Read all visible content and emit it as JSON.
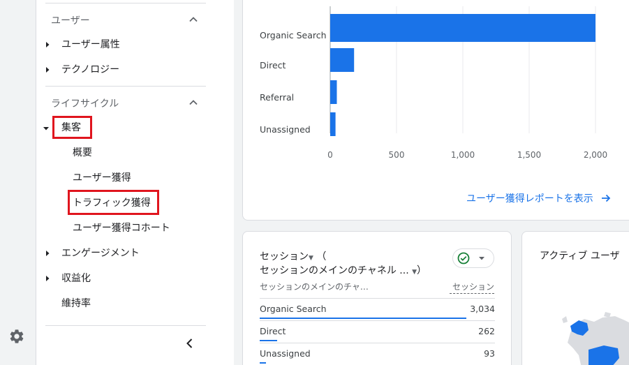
{
  "sidebar": {
    "sections": [
      {
        "title": "ユーザー"
      },
      {
        "title": "ライフサイクル"
      }
    ],
    "user_items": [
      "ユーザー属性",
      "テクノロジー"
    ],
    "lifecycle_items": {
      "acquisition": "集客",
      "acquisition_sub": [
        "概要",
        "ユーザー獲得",
        "トラフィック獲得",
        "ユーザー獲得コホート"
      ],
      "engagement": "エンゲージメント",
      "monetization": "収益化",
      "retention": "維持率"
    }
  },
  "accent_color": "#1a73e8",
  "highlight_color": "#e0151e",
  "chart_data": {
    "type": "bar",
    "orientation": "horizontal",
    "categories": [
      "Organic Search",
      "Direct",
      "Referral",
      "Unassigned"
    ],
    "values": [
      2000,
      180,
      50,
      40
    ],
    "xlim": [
      0,
      2000
    ],
    "xticks": [
      "0",
      "500",
      "1,000",
      "1,500",
      "2,000"
    ],
    "grid": true,
    "color": "#1a73e8"
  },
  "top_card": {
    "link_label": "ユーザー獲得レポートを表示"
  },
  "sessions_card": {
    "title_line1": "セッション",
    "title_paren_open": "（",
    "title_line2": "セッションのメインのチャネル ...",
    "title_paren_close": "）",
    "col_channel": "セッションのメインのチャ…",
    "col_sessions": "セッション",
    "rows": [
      {
        "label": "Organic Search",
        "value": "3,034",
        "fraction": 1.0
      },
      {
        "label": "Direct",
        "value": "262",
        "fraction": 0.086
      },
      {
        "label": "Unassigned",
        "value": "93",
        "fraction": 0.031
      }
    ]
  },
  "active_card": {
    "title": "アクティブ ユーザ"
  }
}
